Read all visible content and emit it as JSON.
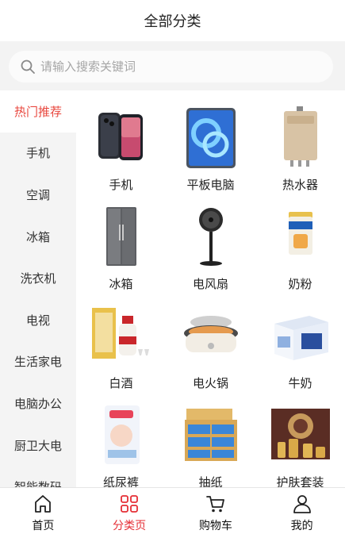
{
  "header": {
    "title": "全部分类"
  },
  "search": {
    "placeholder": "请输入搜索关键词"
  },
  "sidebar": {
    "items": [
      {
        "label": "热门推荐",
        "active": true
      },
      {
        "label": "手机"
      },
      {
        "label": "空调"
      },
      {
        "label": "冰箱"
      },
      {
        "label": "洗衣机"
      },
      {
        "label": "电视"
      },
      {
        "label": "生活家电"
      },
      {
        "label": "电脑办公"
      },
      {
        "label": "厨卫大电"
      },
      {
        "label": "智能数码"
      }
    ]
  },
  "products": [
    {
      "label": "手机",
      "icon": "phone-image"
    },
    {
      "label": "平板电脑",
      "icon": "tablet-image"
    },
    {
      "label": "热水器",
      "icon": "water-heater-image"
    },
    {
      "label": "冰箱",
      "icon": "fridge-image"
    },
    {
      "label": "电风扇",
      "icon": "fan-image"
    },
    {
      "label": "奶粉",
      "icon": "milk-powder-image"
    },
    {
      "label": "白酒",
      "icon": "liquor-image"
    },
    {
      "label": "电火锅",
      "icon": "hotpot-image"
    },
    {
      "label": "牛奶",
      "icon": "milk-box-image"
    },
    {
      "label": "纸尿裤",
      "icon": "diaper-image"
    },
    {
      "label": "抽纸",
      "icon": "tissue-image"
    },
    {
      "label": "护肤套装",
      "icon": "skincare-image"
    }
  ],
  "tabbar": {
    "tabs": [
      {
        "label": "首页",
        "icon": "home-icon"
      },
      {
        "label": "分类页",
        "icon": "category-icon",
        "active": true
      },
      {
        "label": "购物车",
        "icon": "cart-icon"
      },
      {
        "label": "我的",
        "icon": "user-icon"
      }
    ]
  },
  "colors": {
    "accent": "#e52e35",
    "sidebar_bg": "#f4f4f4",
    "search_bg": "#f3f3f3"
  }
}
